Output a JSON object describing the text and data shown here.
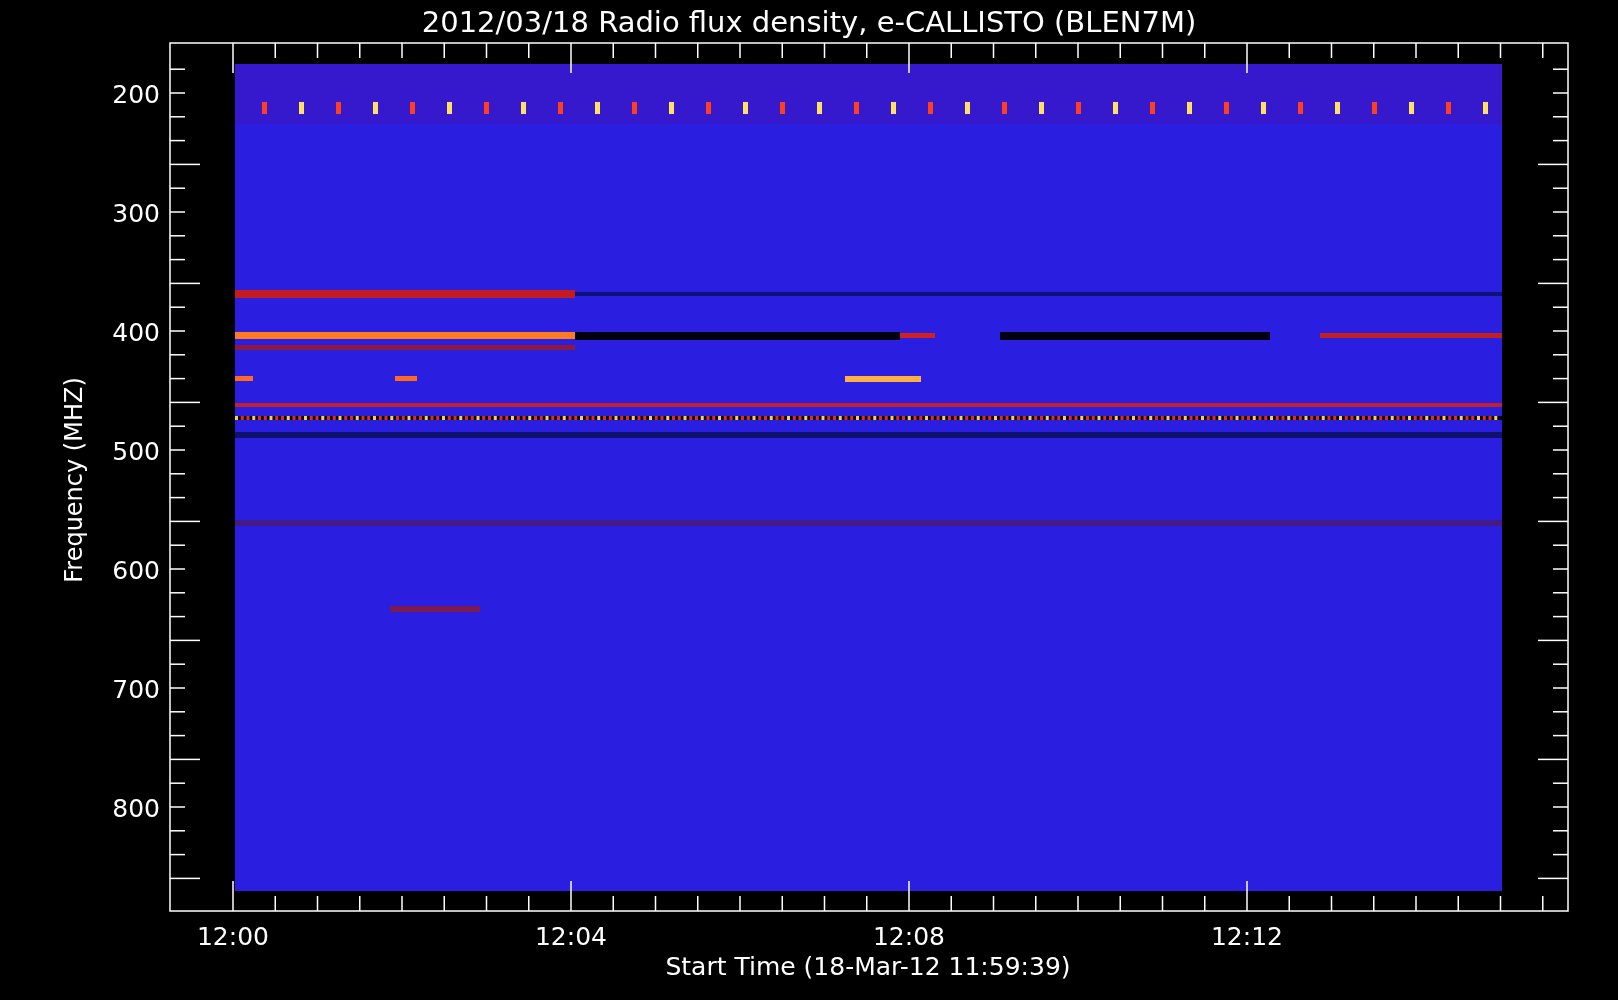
{
  "title": "2012/03/18  Radio flux density, e-CALLISTO (BLEN7M)",
  "y_axis": {
    "label": "Frequency (MHZ)",
    "ticks": [
      "200",
      "300",
      "400",
      "500",
      "600",
      "700",
      "800"
    ]
  },
  "x_axis": {
    "label": "Start Time (18-Mar-12 11:59:39)",
    "ticks": [
      "12:00",
      "12:04",
      "12:08",
      "12:12"
    ]
  }
}
